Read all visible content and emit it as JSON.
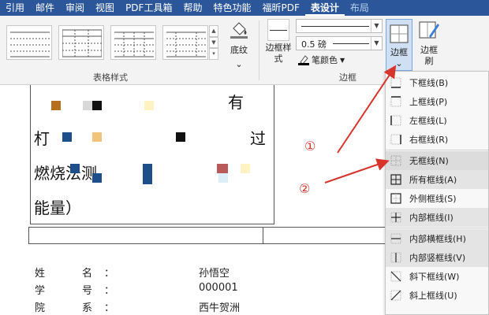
{
  "tabs": [
    "引用",
    "邮件",
    "审阅",
    "视图",
    "PDF工具箱",
    "帮助",
    "特色功能",
    "福昕PDF",
    "表设计",
    "布局"
  ],
  "active_tab_index": 8,
  "ribbon": {
    "shading_label": "底纹",
    "table_styles_group": "表格样式",
    "border_style_label": "边框样式",
    "line_width": "0.5 磅",
    "pen_color_label": "笔颜色",
    "borders_group": "边框",
    "borders_label": "边框",
    "border_painter_label": "边框刷"
  },
  "document": {
    "line1_end": "有",
    "line2_start": "朾",
    "line2_end": "过",
    "line3": "燃烧法测",
    "line4": "能量）",
    "info": [
      {
        "k1": "姓",
        "k2": "名",
        "colon": "：",
        "value": "孙悟空"
      },
      {
        "k1": "学",
        "k2": "号",
        "colon": "：",
        "value": "000001"
      },
      {
        "k1": "院",
        "k2": "系",
        "colon": "：",
        "value": "西牛贺洲"
      }
    ]
  },
  "menu_items": [
    {
      "label": "下框线(B)",
      "icon": "border-bottom-icon"
    },
    {
      "label": "上框线(P)",
      "icon": "border-top-icon"
    },
    {
      "label": "左框线(L)",
      "icon": "border-left-icon"
    },
    {
      "label": "右框线(R)",
      "icon": "border-right-icon"
    },
    {
      "label": "无框线(N)",
      "icon": "no-border-icon"
    },
    {
      "label": "所有框线(A)",
      "icon": "all-borders-icon"
    },
    {
      "label": "外侧框线(S)",
      "icon": "outside-borders-icon"
    },
    {
      "label": "内部框线(I)",
      "icon": "inside-borders-icon"
    },
    {
      "label": "内部横框线(H)",
      "icon": "inside-horizontal-icon"
    },
    {
      "label": "内部竖框线(V)",
      "icon": "inside-vertical-icon"
    },
    {
      "label": "斜下框线(W)",
      "icon": "diagonal-down-icon"
    },
    {
      "label": "斜上框线(U)",
      "icon": "diagonal-up-icon"
    }
  ],
  "annotations": {
    "one": "①",
    "two": "②"
  },
  "colors": {
    "accent": "#2b579a",
    "annotation": "#d9342b"
  }
}
